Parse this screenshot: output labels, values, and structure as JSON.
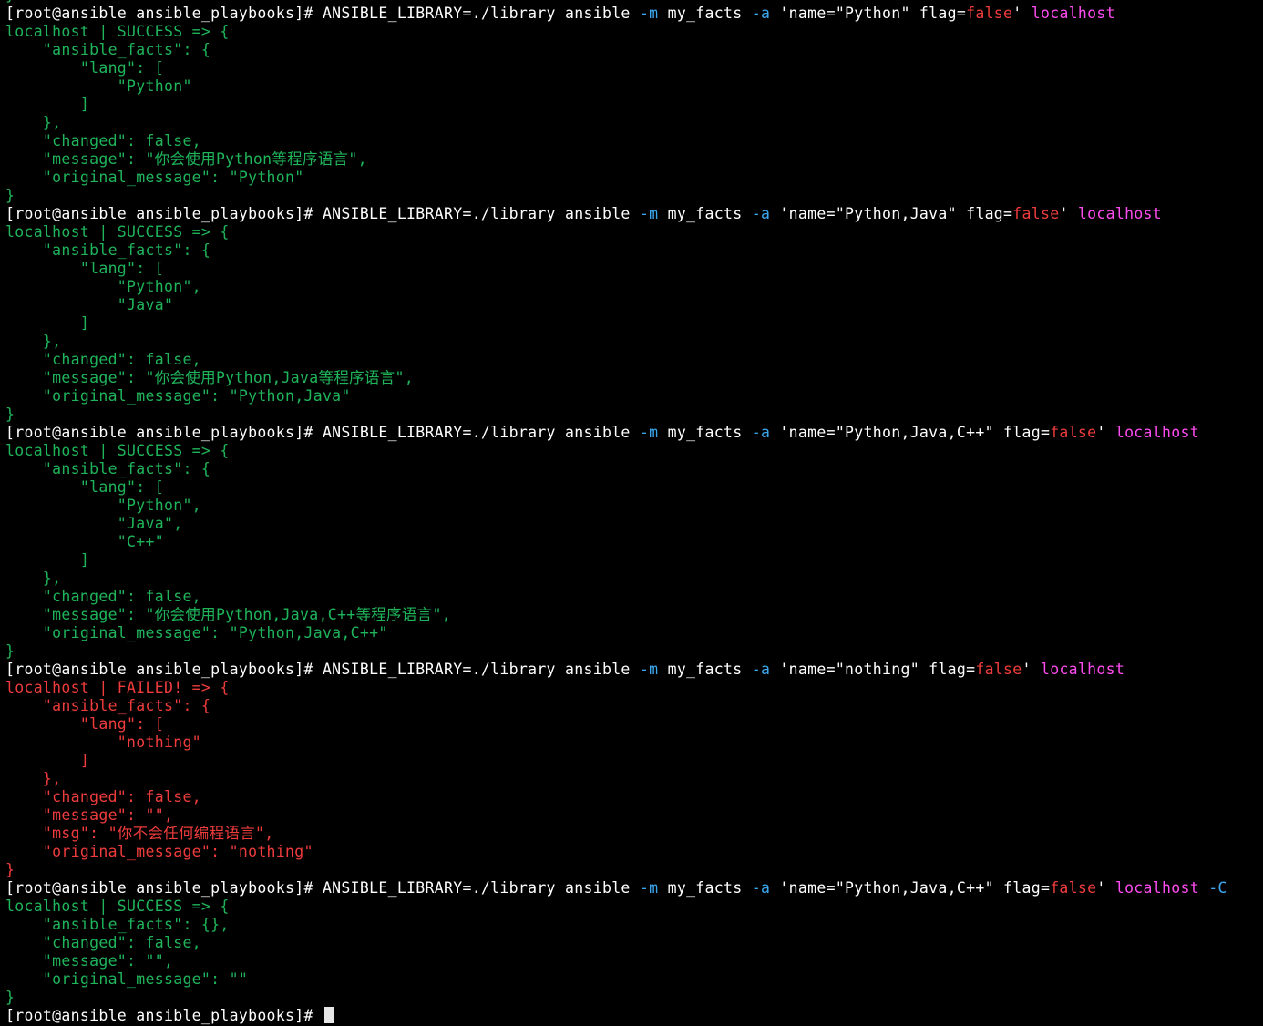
{
  "terminal": {
    "prompt": "[root@ansible ansible_playbooks]#",
    "colors": {
      "command": "#ffffff",
      "option": "#3aa7ee",
      "host": "#ff4cf0",
      "success": "#1fb45a",
      "failed": "#ee3c3c",
      "cursor": "#e6e6e6"
    },
    "lines": [
      [
        {
          "t": "}",
          "c": "c-green"
        }
      ],
      [
        {
          "t": "[root@ansible ansible_playbooks]# ANSIBLE_LIBRARY=./library ansible ",
          "c": "c-white"
        },
        {
          "t": "-m",
          "c": "c-cyan"
        },
        {
          "t": " my_facts ",
          "c": "c-white"
        },
        {
          "t": "-a",
          "c": "c-cyan"
        },
        {
          "t": " 'name=\"Python\" flag=",
          "c": "c-white"
        },
        {
          "t": "false",
          "c": "c-red"
        },
        {
          "t": "' ",
          "c": "c-white"
        },
        {
          "t": "localhost",
          "c": "c-magenta"
        }
      ],
      [
        {
          "t": "localhost | SUCCESS => {",
          "c": "c-green"
        }
      ],
      [
        {
          "t": "    \"ansible_facts\": {",
          "c": "c-green"
        }
      ],
      [
        {
          "t": "        \"lang\": [",
          "c": "c-green"
        }
      ],
      [
        {
          "t": "            \"Python\"",
          "c": "c-green"
        }
      ],
      [
        {
          "t": "        ]",
          "c": "c-green"
        }
      ],
      [
        {
          "t": "    },",
          "c": "c-green"
        }
      ],
      [
        {
          "t": "    \"changed\": false,",
          "c": "c-green"
        }
      ],
      [
        {
          "t": "    \"message\": \"你会使用Python等程序语言\",",
          "c": "c-green"
        }
      ],
      [
        {
          "t": "    \"original_message\": \"Python\"",
          "c": "c-green"
        }
      ],
      [
        {
          "t": "}",
          "c": "c-green"
        }
      ],
      [
        {
          "t": "[root@ansible ansible_playbooks]# ANSIBLE_LIBRARY=./library ansible ",
          "c": "c-white"
        },
        {
          "t": "-m",
          "c": "c-cyan"
        },
        {
          "t": " my_facts ",
          "c": "c-white"
        },
        {
          "t": "-a",
          "c": "c-cyan"
        },
        {
          "t": " 'name=\"Python,Java\" flag=",
          "c": "c-white"
        },
        {
          "t": "false",
          "c": "c-red"
        },
        {
          "t": "' ",
          "c": "c-white"
        },
        {
          "t": "localhost",
          "c": "c-magenta"
        }
      ],
      [
        {
          "t": "localhost | SUCCESS => {",
          "c": "c-green"
        }
      ],
      [
        {
          "t": "    \"ansible_facts\": {",
          "c": "c-green"
        }
      ],
      [
        {
          "t": "        \"lang\": [",
          "c": "c-green"
        }
      ],
      [
        {
          "t": "            \"Python\",",
          "c": "c-green"
        }
      ],
      [
        {
          "t": "            \"Java\"",
          "c": "c-green"
        }
      ],
      [
        {
          "t": "        ]",
          "c": "c-green"
        }
      ],
      [
        {
          "t": "    },",
          "c": "c-green"
        }
      ],
      [
        {
          "t": "    \"changed\": false,",
          "c": "c-green"
        }
      ],
      [
        {
          "t": "    \"message\": \"你会使用Python,Java等程序语言\",",
          "c": "c-green"
        }
      ],
      [
        {
          "t": "    \"original_message\": \"Python,Java\"",
          "c": "c-green"
        }
      ],
      [
        {
          "t": "}",
          "c": "c-green"
        }
      ],
      [
        {
          "t": "[root@ansible ansible_playbooks]# ANSIBLE_LIBRARY=./library ansible ",
          "c": "c-white"
        },
        {
          "t": "-m",
          "c": "c-cyan"
        },
        {
          "t": " my_facts ",
          "c": "c-white"
        },
        {
          "t": "-a",
          "c": "c-cyan"
        },
        {
          "t": " 'name=\"Python,Java,C++\" flag=",
          "c": "c-white"
        },
        {
          "t": "false",
          "c": "c-red"
        },
        {
          "t": "' ",
          "c": "c-white"
        },
        {
          "t": "localhost",
          "c": "c-magenta"
        }
      ],
      [
        {
          "t": "localhost | SUCCESS => {",
          "c": "c-green"
        }
      ],
      [
        {
          "t": "    \"ansible_facts\": {",
          "c": "c-green"
        }
      ],
      [
        {
          "t": "        \"lang\": [",
          "c": "c-green"
        }
      ],
      [
        {
          "t": "            \"Python\",",
          "c": "c-green"
        }
      ],
      [
        {
          "t": "            \"Java\",",
          "c": "c-green"
        }
      ],
      [
        {
          "t": "            \"C++\"",
          "c": "c-green"
        }
      ],
      [
        {
          "t": "        ]",
          "c": "c-green"
        }
      ],
      [
        {
          "t": "    },",
          "c": "c-green"
        }
      ],
      [
        {
          "t": "    \"changed\": false,",
          "c": "c-green"
        }
      ],
      [
        {
          "t": "    \"message\": \"你会使用Python,Java,C++等程序语言\",",
          "c": "c-green"
        }
      ],
      [
        {
          "t": "    \"original_message\": \"Python,Java,C++\"",
          "c": "c-green"
        }
      ],
      [
        {
          "t": "}",
          "c": "c-green"
        }
      ],
      [
        {
          "t": "[root@ansible ansible_playbooks]# ANSIBLE_LIBRARY=./library ansible ",
          "c": "c-white"
        },
        {
          "t": "-m",
          "c": "c-cyan"
        },
        {
          "t": " my_facts ",
          "c": "c-white"
        },
        {
          "t": "-a",
          "c": "c-cyan"
        },
        {
          "t": " 'name=\"nothing\" flag=",
          "c": "c-white"
        },
        {
          "t": "false",
          "c": "c-red"
        },
        {
          "t": "' ",
          "c": "c-white"
        },
        {
          "t": "localhost",
          "c": "c-magenta"
        }
      ],
      [
        {
          "t": "localhost | FAILED! => {",
          "c": "c-red"
        }
      ],
      [
        {
          "t": "    \"ansible_facts\": {",
          "c": "c-red"
        }
      ],
      [
        {
          "t": "        \"lang\": [",
          "c": "c-red"
        }
      ],
      [
        {
          "t": "            \"nothing\"",
          "c": "c-red"
        }
      ],
      [
        {
          "t": "        ]",
          "c": "c-red"
        }
      ],
      [
        {
          "t": "    },",
          "c": "c-red"
        }
      ],
      [
        {
          "t": "    \"changed\": false,",
          "c": "c-red"
        }
      ],
      [
        {
          "t": "    \"message\": \"\",",
          "c": "c-red"
        }
      ],
      [
        {
          "t": "    \"msg\": \"你不会任何编程语言\",",
          "c": "c-red"
        }
      ],
      [
        {
          "t": "    \"original_message\": \"nothing\"",
          "c": "c-red"
        }
      ],
      [
        {
          "t": "}",
          "c": "c-red"
        }
      ],
      [
        {
          "t": "[root@ansible ansible_playbooks]# ANSIBLE_LIBRARY=./library ansible ",
          "c": "c-white"
        },
        {
          "t": "-m",
          "c": "c-cyan"
        },
        {
          "t": " my_facts ",
          "c": "c-white"
        },
        {
          "t": "-a",
          "c": "c-cyan"
        },
        {
          "t": " 'name=\"Python,Java,C++\" flag=",
          "c": "c-white"
        },
        {
          "t": "false",
          "c": "c-red"
        },
        {
          "t": "' ",
          "c": "c-white"
        },
        {
          "t": "localhost",
          "c": "c-magenta"
        },
        {
          "t": " ",
          "c": "c-white"
        },
        {
          "t": "-C",
          "c": "c-cyan"
        }
      ],
      [
        {
          "t": "localhost | SUCCESS => {",
          "c": "c-green"
        }
      ],
      [
        {
          "t": "    \"ansible_facts\": {},",
          "c": "c-green"
        }
      ],
      [
        {
          "t": "    \"changed\": false,",
          "c": "c-green"
        }
      ],
      [
        {
          "t": "    \"message\": \"\",",
          "c": "c-green"
        }
      ],
      [
        {
          "t": "    \"original_message\": \"\"",
          "c": "c-green"
        }
      ],
      [
        {
          "t": "}",
          "c": "c-green"
        }
      ]
    ]
  }
}
